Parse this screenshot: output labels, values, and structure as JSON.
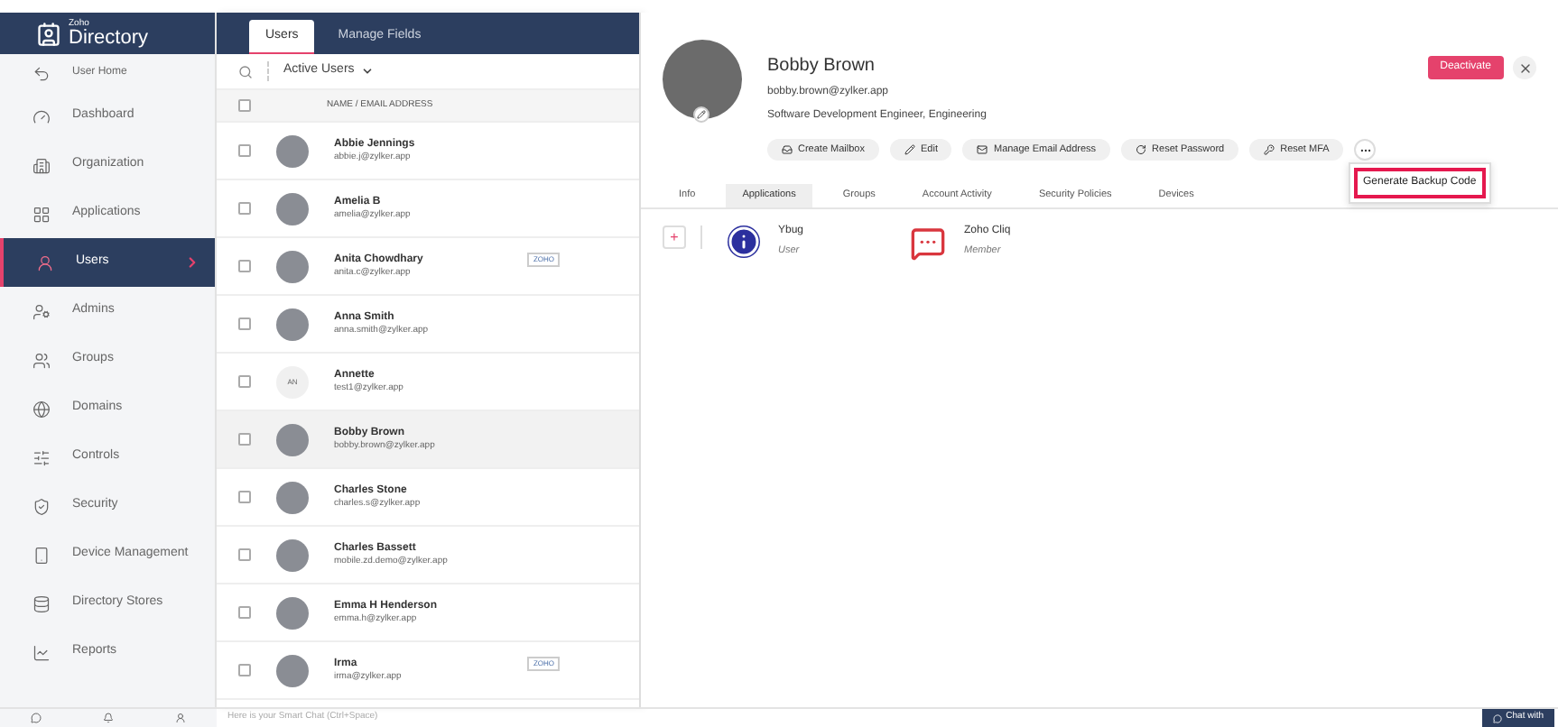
{
  "app": {
    "brand_small": "Zoho",
    "brand": "Directory"
  },
  "sidebar": {
    "items": [
      {
        "label": "User Home",
        "kind": "back",
        "selected": false
      },
      {
        "label": "Dashboard",
        "kind": "item",
        "selected": false
      },
      {
        "label": "Organization",
        "kind": "item",
        "selected": false
      },
      {
        "label": "Applications",
        "kind": "item",
        "selected": false
      },
      {
        "label": "Users",
        "kind": "item",
        "selected": true
      },
      {
        "label": "Admins",
        "kind": "item",
        "selected": false
      },
      {
        "label": "Groups",
        "kind": "item",
        "selected": false
      },
      {
        "label": "Domains",
        "kind": "item",
        "selected": false
      },
      {
        "label": "Controls",
        "kind": "item",
        "selected": false
      },
      {
        "label": "Security",
        "kind": "item",
        "selected": false
      },
      {
        "label": "Device Management",
        "kind": "item",
        "selected": false
      },
      {
        "label": "Directory Stores",
        "kind": "item",
        "selected": false
      },
      {
        "label": "Reports",
        "kind": "item",
        "selected": false
      }
    ]
  },
  "list_tabs": [
    {
      "label": "Users",
      "selected": true
    },
    {
      "label": "Manage Fields",
      "selected": false
    }
  ],
  "filter": "Active Users",
  "column_header": "NAME / EMAIL ADDRESS",
  "select_all": {
    "checked": false
  },
  "users": [
    {
      "name": "Abbie Jennings",
      "email": "abbie.j@zylker.app",
      "selected": false,
      "checked": false
    },
    {
      "name": "Amelia B",
      "email": "amelia@zylker.app",
      "selected": false,
      "checked": false
    },
    {
      "name": "Anita Chowdhary",
      "email": "anita.c@zylker.app",
      "badge": "ZOHO",
      "selected": false,
      "checked": false
    },
    {
      "name": "Anna Smith",
      "email": "anna.smith@zylker.app",
      "selected": false,
      "checked": false
    },
    {
      "name": "Annette",
      "email": "test1@zylker.app",
      "initials": "AN",
      "selected": false,
      "checked": false
    },
    {
      "name": "Bobby Brown",
      "email": "bobby.brown@zylker.app",
      "selected": true,
      "checked": false
    },
    {
      "name": "Charles Stone",
      "email": "charles.s@zylker.app",
      "selected": false,
      "checked": false
    },
    {
      "name": "Charles Bassett",
      "email": "mobile.zd.demo@zylker.app",
      "selected": false,
      "checked": false
    },
    {
      "name": "Emma H Henderson",
      "email": "emma.h@zylker.app",
      "selected": false,
      "checked": false
    },
    {
      "name": "Irma",
      "email": "irma@zylker.app",
      "badge": "ZOHO",
      "selected": false,
      "checked": false
    }
  ],
  "detail": {
    "name": "Bobby Brown",
    "email": "bobby.brown@zylker.app",
    "title": "Software Development Engineer, Engineering",
    "deactivate": "Deactivate",
    "actions": [
      {
        "label": "Create Mailbox",
        "kind": "mailbox"
      },
      {
        "label": "Edit",
        "kind": "edit"
      },
      {
        "label": "Manage Email Address",
        "kind": "email"
      },
      {
        "label": "Reset Password",
        "kind": "reset"
      },
      {
        "label": "Reset MFA",
        "kind": "mfa"
      }
    ],
    "menu": [
      {
        "label": "Generate Backup Code",
        "selected": true
      }
    ],
    "tabs": [
      {
        "label": "Info",
        "selected": false
      },
      {
        "label": "Applications",
        "selected": true
      },
      {
        "label": "Groups",
        "selected": false
      },
      {
        "label": "Account Activity",
        "selected": false
      },
      {
        "label": "Security Policies",
        "selected": false
      },
      {
        "label": "Devices",
        "selected": false
      }
    ],
    "add": "+",
    "apps": [
      {
        "name": "Ybug",
        "role": "User",
        "kind": "ybug"
      },
      {
        "name": "Zoho Cliq",
        "role": "Member",
        "kind": "cliq"
      }
    ]
  },
  "bottom": {
    "smart_chat": "Here is your Smart Chat (Ctrl+Space)",
    "chat_button": "Chat with"
  }
}
